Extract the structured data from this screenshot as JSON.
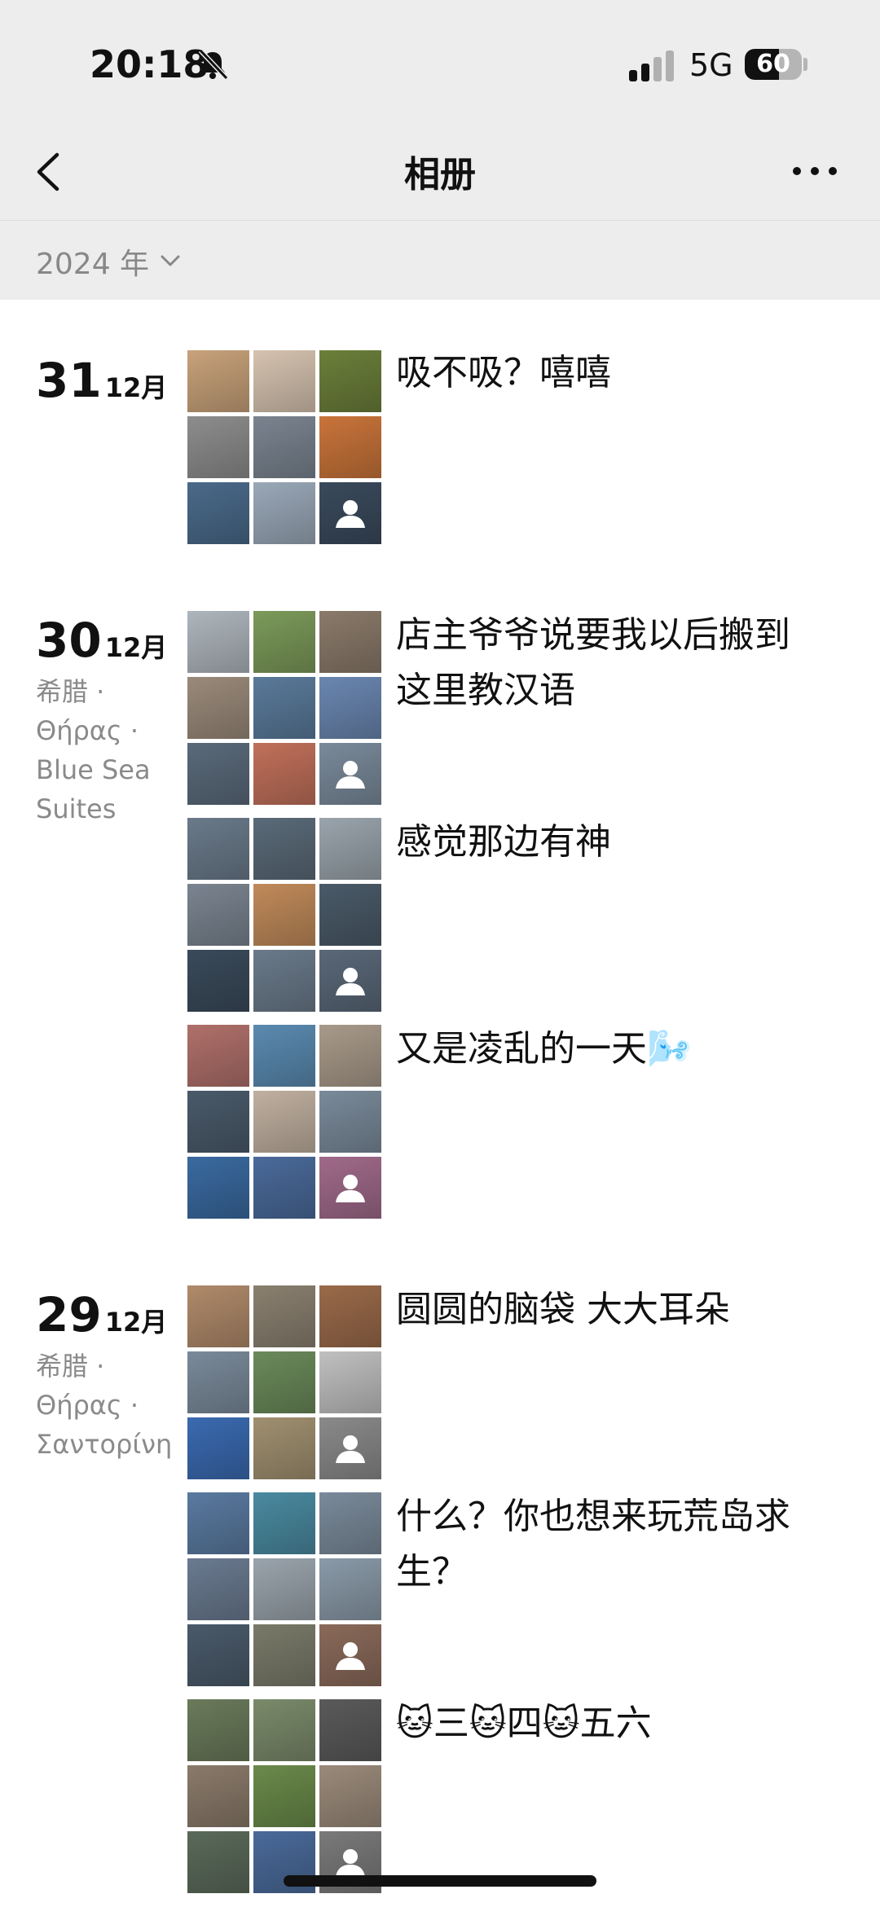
{
  "status_bar": {
    "time": "20:18",
    "network": "5G",
    "battery": "60",
    "battery_level": 0.6
  },
  "nav": {
    "title": "相册"
  },
  "year_filter": {
    "label": "2024 年"
  },
  "entries": [
    {
      "day": "31",
      "month": "12月",
      "location": "",
      "posts": [
        {
          "caption": "吸不吸？嘻嘻",
          "thumbs": [
            "#c8a27a",
            "#d6c3b0",
            "#6b7f3a",
            "#8d8d8d",
            "#7a8490",
            "#c9743a",
            "#4a6a8a",
            "#9aa8b8",
            "#3a4a5c"
          ]
        }
      ]
    },
    {
      "day": "30",
      "month": "12月",
      "location": "希腊 · Θήρας · Blue Sea Suites",
      "posts": [
        {
          "caption": "店主爷爷说要我以后搬到这里教汉语",
          "thumbs": [
            "#aeb6bd",
            "#7c9a5a",
            "#8a7a6a",
            "#9a8a7a",
            "#5a7a9a",
            "#6a86b0",
            "#5a6a7a",
            "#c0705a",
            "#7a8a9a"
          ]
        },
        {
          "caption": "感觉那边有神",
          "thumbs": [
            "#6a7a8a",
            "#5a6a78",
            "#9aa4ac",
            "#7a8490",
            "#c08a5a",
            "#4a5a68",
            "#3a4a5a",
            "#6a7a8a",
            "#5a6878"
          ]
        },
        {
          "caption": "又是凌乱的一天🌬️",
          "thumbs": [
            "#b0706a",
            "#5a8ab0",
            "#a89a8a",
            "#4a5a6a",
            "#c0b0a0",
            "#7a8a9a",
            "#3a6aa0",
            "#4a6a9a",
            "#a06a8a"
          ]
        }
      ]
    },
    {
      "day": "29",
      "month": "12月",
      "location": "希腊 · Θήρας · Σαντορίνη",
      "posts": [
        {
          "caption": "圆圆的脑袋 大大耳朵",
          "thumbs": [
            "#b08a6a",
            "#8a8070",
            "#9a6a4a",
            "#7a8a9a",
            "#6a8a5a",
            "#c0c0c0",
            "#3a6ab0",
            "#a09070",
            "#8a8a8a"
          ]
        },
        {
          "caption": "什么？你也想来玩荒岛求生？",
          "thumbs": [
            "#5a7aa0",
            "#4a8aa0",
            "#7a8a9a",
            "#6a7a90",
            "#9aa4ac",
            "#8a9aa8",
            "#4a5a6a",
            "#7a7a6a",
            "#8a6a5a"
          ]
        },
        {
          "caption": "🐱三🐱四🐱五六",
          "thumbs": [
            "#6a7a5a",
            "#7a8a6a",
            "#5a5a5a",
            "#8a7a6a",
            "#6a8a4a",
            "#9a8a7a",
            "#5a6a5a",
            "#4a6a9a",
            "#7a7a7a"
          ]
        }
      ]
    }
  ]
}
